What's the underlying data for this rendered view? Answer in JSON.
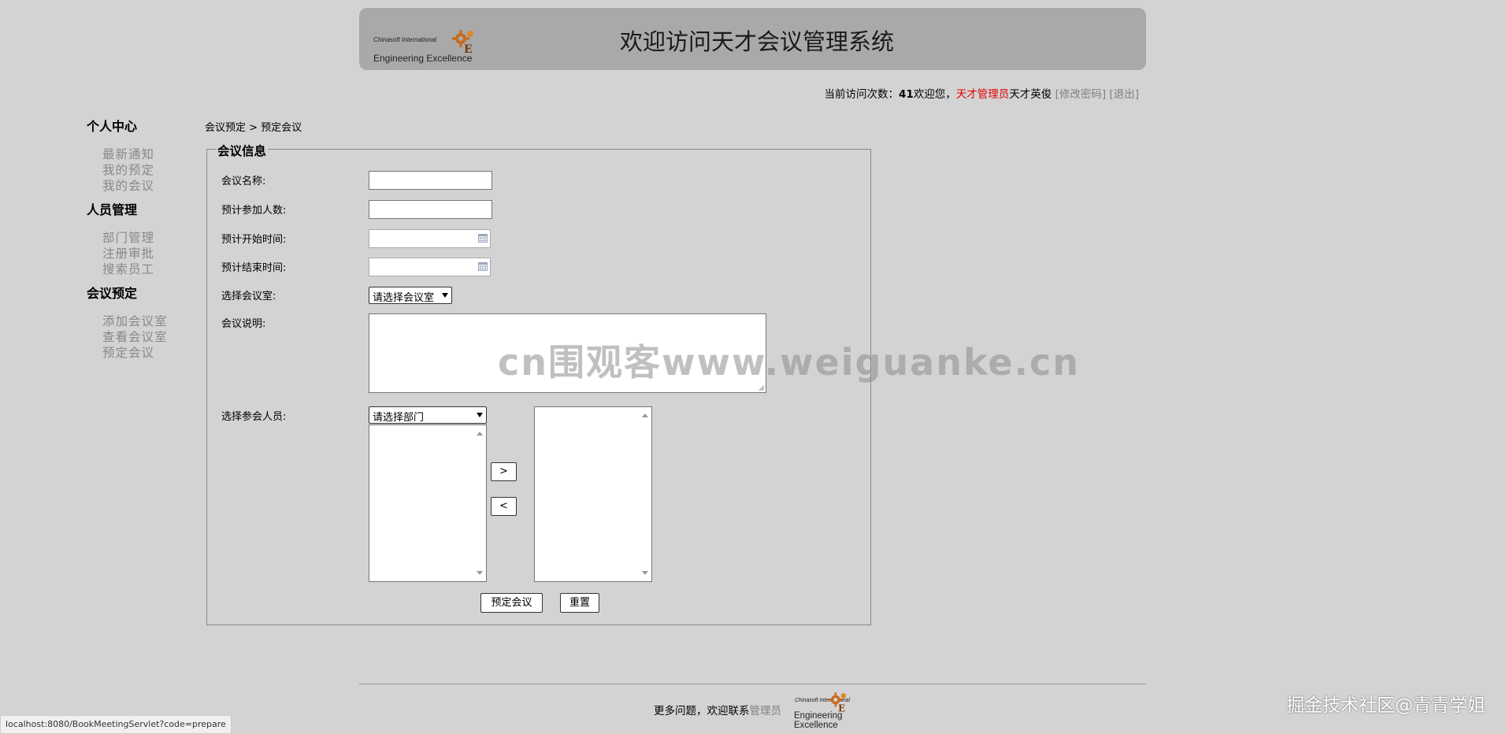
{
  "header": {
    "logo_line1": "Chinasoft International",
    "logo_line2": "Engineering Excellence",
    "title": "欢迎访问天才会议管理系统"
  },
  "userbar": {
    "visits_label": "当前访问次数：",
    "visits_count": "41",
    "welcome": "欢迎您，",
    "role": "天才管理员",
    "username": "天才英俊",
    "change_password": "[修改密码]",
    "logout": "[退出]"
  },
  "sidebar": {
    "groups": [
      {
        "title": "个人中心",
        "items": [
          "最新通知",
          "我的预定",
          "我的会议"
        ]
      },
      {
        "title": "人员管理",
        "items": [
          "部门管理",
          "注册审批",
          "搜索员工"
        ]
      },
      {
        "title": "会议预定",
        "items": [
          "添加会议室",
          "查看会议室",
          "预定会议"
        ]
      }
    ]
  },
  "breadcrumb": "会议预定 > 预定会议",
  "form": {
    "legend": "会议信息",
    "name_label": "会议名称:",
    "count_label": "预计参加人数:",
    "start_label": "预计开始时间:",
    "end_label": "预计结束时间:",
    "room_label": "选择会议室:",
    "room_select": "请选择会议室",
    "desc_label": "会议说明:",
    "attendees_label": "选择参会人员:",
    "dept_select": "请选择部门",
    "add_button": ">",
    "remove_button": "<",
    "submit_button": "预定会议",
    "reset_button": "重置"
  },
  "watermark": "cn围观客www.weiguanke.cn",
  "footer": {
    "text": "更多问题，欢迎联系",
    "admin_link": "管理员",
    "logo_line1": "Chinasoft International",
    "logo_line2a": "Engineering",
    "logo_line2b": "Excellence"
  },
  "status_url": "localhost:8080/BookMeetingServlet?code=prepare",
  "credit": "掘金技术社区@青青学姐"
}
